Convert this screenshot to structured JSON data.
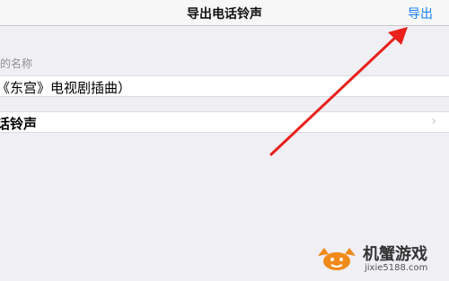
{
  "navbar": {
    "title": "导出电话铃声",
    "export_label": "导出"
  },
  "section": {
    "header": "的名称"
  },
  "rows": {
    "name_value": "《东宫》电视剧插曲）",
    "ringtone_label": "话铃声",
    "chevron": "›"
  },
  "watermark": {
    "name": "机蟹游戏",
    "url": "jixie5188.com"
  },
  "colors": {
    "accent": "#1a7ff5",
    "arrow": "#e8211c",
    "background": "#efeff4"
  }
}
